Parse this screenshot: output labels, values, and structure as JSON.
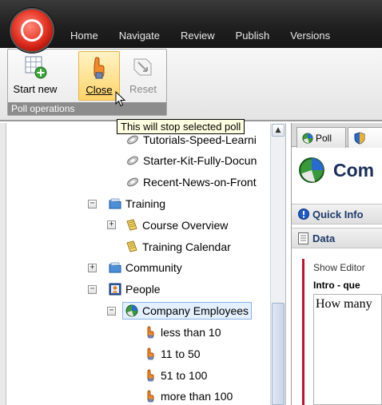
{
  "ribbon": {
    "tabs": [
      "Home",
      "Navigate",
      "Review",
      "Publish",
      "Versions"
    ],
    "group_label": "Poll operations",
    "buttons": {
      "start_new": "Start new",
      "close": "Close",
      "reset": "Reset"
    }
  },
  "tooltip": "This will stop selected poll",
  "tree": {
    "items": [
      {
        "label": "Tutorials-Speed-Learni"
      },
      {
        "label": "Starter-Kit-Fully-Docun"
      },
      {
        "label": "Recent-News-on-Front"
      },
      {
        "label": "Training"
      },
      {
        "label": "Course Overview"
      },
      {
        "label": "Training Calendar"
      },
      {
        "label": "Community"
      },
      {
        "label": "People"
      },
      {
        "label": "Company Employees"
      },
      {
        "label": "less than 10"
      },
      {
        "label": "11 to 50"
      },
      {
        "label": "51 to 100"
      },
      {
        "label": "more than 100"
      }
    ]
  },
  "editor": {
    "tabs": [
      "Poll",
      ""
    ],
    "heading": "Com",
    "quick_info": "Quick Info",
    "data": "Data",
    "show_editor": "Show Editor",
    "intro": "Intro - que",
    "content": "How many"
  },
  "colors": {
    "accent_red": "#c8102e",
    "selection": "#e4f0ff",
    "tooltip_bg": "#ffffe1"
  }
}
